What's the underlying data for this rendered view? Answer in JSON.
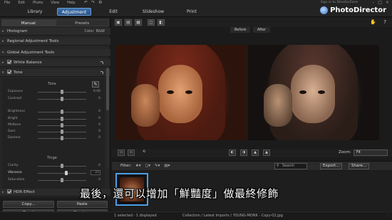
{
  "menu": [
    "File",
    "Edit",
    "Photo",
    "View",
    "Help"
  ],
  "modes": {
    "library": "Library",
    "adjustment": "Adjustment",
    "edit": "Edit",
    "slideshow": "Slideshow",
    "print": "Print"
  },
  "brand": {
    "name": "PhotoDirector",
    "upgrade": "Sign in to DirectorZone"
  },
  "left": {
    "tabs": {
      "manual": "Manual",
      "presets": "Presets"
    },
    "histogram": {
      "label": "Histogram",
      "mode": "Color",
      "alt": "B&W"
    },
    "regional": "Regional Adjustment Tools",
    "global": "Global Adjustment Tools",
    "white_balance": "White Balance",
    "tone": "Tone",
    "tone_group": {
      "title": "Tone",
      "sliders": [
        {
          "label": "Exposure",
          "value": "0.00"
        },
        {
          "label": "Contrast",
          "value": "0"
        },
        {
          "label": "Brightness",
          "value": "0"
        },
        {
          "label": "Bright",
          "value": "0"
        },
        {
          "label": "Midtone",
          "value": "0"
        },
        {
          "label": "Dark",
          "value": "0"
        },
        {
          "label": "Darkest",
          "value": "0"
        }
      ]
    },
    "tinge_group": {
      "title": "Tinge",
      "sliders": [
        {
          "label": "Clarity",
          "value": "0"
        },
        {
          "label": "Vibrance",
          "value": "22"
        },
        {
          "label": "Saturation",
          "value": "0"
        }
      ]
    },
    "hdr": "HDR Effect",
    "buttons": {
      "copy": "Copy...",
      "paste": "Paste",
      "reset": "Reset",
      "create": "Create..."
    }
  },
  "view": {
    "before": "Before",
    "after": "After"
  },
  "zoom": {
    "label": "Zoom:",
    "value": "Fit"
  },
  "filter": {
    "label": "Filter:",
    "search_placeholder": "Search",
    "export": "Export...",
    "share": "Share..."
  },
  "status": {
    "selected": "1 selected - 1 displayed",
    "path": "Collection / Latest Imports / YOUNG-MONK - Copy-02.jpg"
  },
  "subtitle": "最後，還可以增加「鮮豔度」做最終修飾",
  "colors": {
    "accent": "#3d6fa8",
    "selection": "#4a9fe8"
  }
}
